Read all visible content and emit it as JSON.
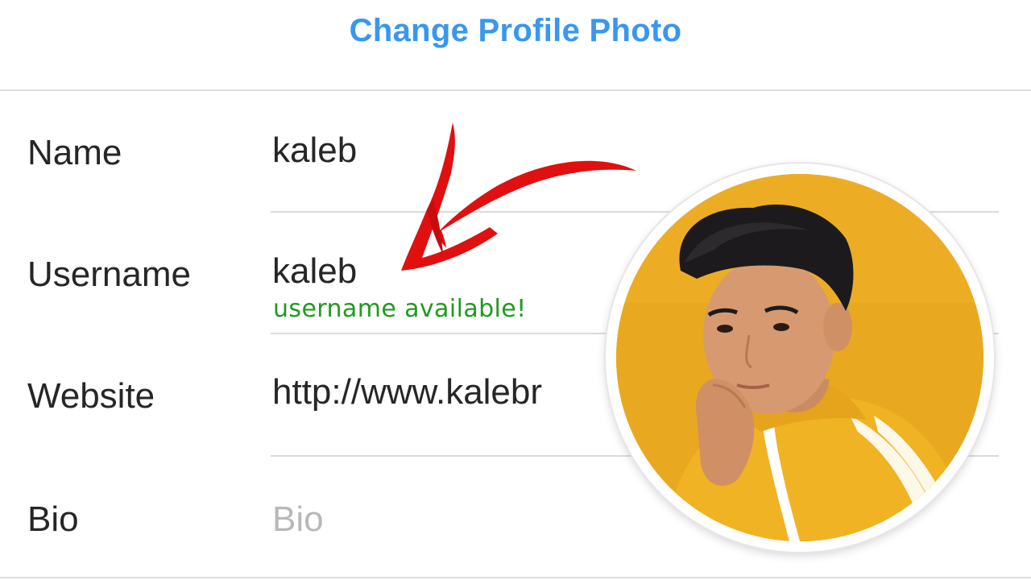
{
  "header": {
    "change_photo_label": "Change Profile Photo"
  },
  "form": {
    "name": {
      "label": "Name",
      "value": "kaleb"
    },
    "username": {
      "label": "Username",
      "value": "kaleb",
      "status": "username available!"
    },
    "website": {
      "label": "Website",
      "value": "http://www.kalebr"
    },
    "bio": {
      "label": "Bio",
      "placeholder": "Bio"
    }
  },
  "colors": {
    "link_blue": "#3897f0",
    "success_green": "#1f9a1f",
    "arrow_red": "#e01010",
    "avatar_background": "#e8a920",
    "jacket_yellow": "#f0b323"
  },
  "overlays": {
    "arrow_icon": "red-arrow-icon",
    "avatar": "profile-photo"
  }
}
